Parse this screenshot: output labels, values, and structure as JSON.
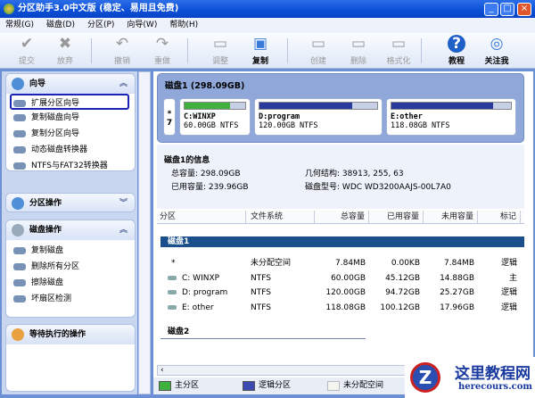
{
  "window": {
    "title": "分区助手3.0中文版 (稳定、易用且免费)",
    "min": "_",
    "max": "□",
    "close": "×"
  },
  "menu": [
    "常规(G)",
    "磁盘(D)",
    "分区(P)",
    "向导(W)",
    "帮助(H)"
  ],
  "toolbar": [
    {
      "label": "提交",
      "icon": "check-icon",
      "glyph": "✔",
      "on": false
    },
    {
      "label": "放弃",
      "icon": "x-icon",
      "glyph": "✖",
      "on": false
    },
    {
      "label": "撤销",
      "icon": "undo-icon",
      "glyph": "↶",
      "on": false
    },
    {
      "label": "重做",
      "icon": "redo-icon",
      "glyph": "↷",
      "on": false
    },
    {
      "label": "调整",
      "icon": "resize-icon",
      "glyph": "▭",
      "on": false
    },
    {
      "label": "复制",
      "icon": "copy-icon",
      "glyph": "▣",
      "on": true
    },
    {
      "label": "创建",
      "icon": "create-icon",
      "glyph": "▭",
      "on": false
    },
    {
      "label": "删除",
      "icon": "delete-icon",
      "glyph": "▭",
      "on": false
    },
    {
      "label": "格式化",
      "icon": "format-icon",
      "glyph": "▭",
      "on": false
    },
    {
      "label": "教程",
      "icon": "help-icon",
      "glyph": "?",
      "on": true
    },
    {
      "label": "关注我",
      "icon": "follow-icon",
      "glyph": "◎",
      "on": true
    }
  ],
  "sidebar": {
    "wizard": {
      "title": "向导",
      "items": [
        "扩展分区向导",
        "复制磁盘向导",
        "复制分区向导",
        "动态磁盘转换器",
        "NTFS与FAT32转换器"
      ]
    },
    "partition_ops": {
      "title": "分区操作"
    },
    "disk_ops": {
      "title": "磁盘操作",
      "items": [
        "复制磁盘",
        "删除所有分区",
        "擦除磁盘",
        "坏扇区检测"
      ]
    },
    "pending": {
      "title": "等待执行的操作"
    }
  },
  "diskmap": {
    "title": "磁盘1 (298.09GB)",
    "unalloc": [
      "*",
      "7"
    ],
    "parts": [
      {
        "name": "C:WINXP",
        "size": "60.00GB NTFS",
        "used_pct": 75,
        "color": "#3fb13f"
      },
      {
        "name": "D:program",
        "size": "120.00GB NTFS",
        "used_pct": 79,
        "color": "#2a3a9c"
      },
      {
        "name": "E:other",
        "size": "118.08GB NTFS",
        "used_pct": 85,
        "color": "#2a3a9c"
      }
    ]
  },
  "info": {
    "title": "磁盘1的信息",
    "total_label": "总容量:",
    "total": "298.09GB",
    "used_label": "已用容量:",
    "used": "239.96GB",
    "geo_label": "几何结构:",
    "geo": "38913, 255, 63",
    "model_label": "磁盘型号:",
    "model": "WDC WD3200AAJS-00L7A0"
  },
  "table": {
    "headers": [
      "分区",
      "文件系统",
      "总容量",
      "已用容量",
      "未用容量",
      "标记"
    ],
    "disk1": "磁盘1",
    "disk2": "磁盘2",
    "rows": [
      [
        "*",
        "未分配空间",
        "7.84MB",
        "0.00KB",
        "7.84MB",
        "逻辑"
      ],
      [
        "C: WINXP",
        "NTFS",
        "60.00GB",
        "45.12GB",
        "14.88GB",
        "主"
      ],
      [
        "D: program",
        "NTFS",
        "120.00GB",
        "94.72GB",
        "25.27GB",
        "逻辑"
      ],
      [
        "E: other",
        "NTFS",
        "118.08GB",
        "100.12GB",
        "17.96GB",
        "逻辑"
      ]
    ]
  },
  "legend": [
    "主分区",
    "逻辑分区",
    "未分配空间"
  ],
  "watermark": {
    "name": "这里教程网",
    "url": "herecours.com"
  }
}
